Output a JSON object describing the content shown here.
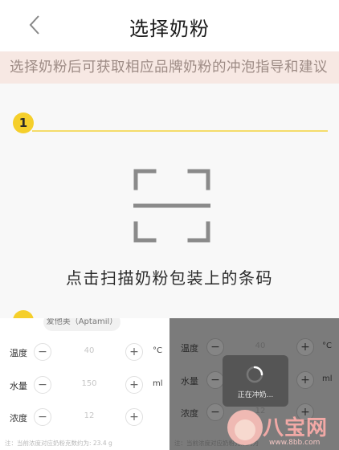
{
  "header": {
    "title": "选择奶粉",
    "back_icon": "chevron-left-icon"
  },
  "notice": {
    "text": "选择奶粉后可获取相应品牌奶粉的冲泡指导和建议"
  },
  "step": {
    "number": "1",
    "badge_color": "#f5cf2b"
  },
  "scan": {
    "icon": "scan-frame-icon",
    "hint": "点击扫描奶粉包装上的条码"
  },
  "panel_left": {
    "brand": "爱他美（Aptamil）",
    "rows": [
      {
        "label": "温度",
        "value": "40",
        "unit": "°C"
      },
      {
        "label": "水量",
        "value": "150",
        "unit": "ml"
      },
      {
        "label": "浓度",
        "value": "12",
        "unit": ""
      }
    ],
    "minus": "−",
    "plus": "+",
    "note": "注：当前浓度对应奶粉克数约为: 23.4 g"
  },
  "panel_right": {
    "rows": [
      {
        "label": "温度",
        "value": "40",
        "unit": "°C"
      },
      {
        "label": "水量",
        "value": "",
        "unit": "ml"
      },
      {
        "label": "浓度",
        "value": "12",
        "unit": ""
      }
    ],
    "minus": "−",
    "plus": "+",
    "loading_text": "正在冲奶...",
    "note": "注：当前浓度对应奶粉克数约为"
  },
  "watermark": {
    "name": "八宝网",
    "url": "www.8bb.com"
  },
  "colors": {
    "accent_yellow": "#f5cf2b",
    "notice_bg": "#f7e8e3",
    "notice_text": "#9d8b85"
  }
}
